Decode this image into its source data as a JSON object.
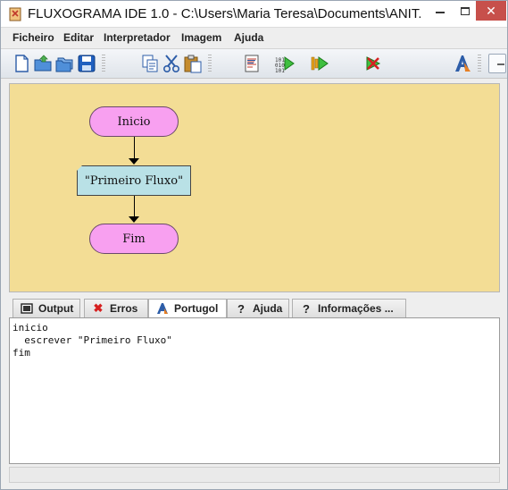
{
  "window": {
    "title": "FLUXOGRAMA IDE 1.0 - C:\\Users\\Maria Teresa\\Documents\\ANIT..."
  },
  "menu": {
    "items": [
      {
        "label": "Ficheiro"
      },
      {
        "label": "Editar"
      },
      {
        "label": "Interpretador"
      },
      {
        "label": "Imagem"
      },
      {
        "label": "Ajuda"
      }
    ]
  },
  "toolbar": {
    "buttons": [
      {
        "icon": "new-file-icon"
      },
      {
        "icon": "open-folder-icon"
      },
      {
        "icon": "open-multiple-icon"
      },
      {
        "icon": "save-icon"
      },
      {
        "icon": "copy-icon"
      },
      {
        "icon": "cut-icon"
      },
      {
        "icon": "paste-icon"
      },
      {
        "icon": "code-view-icon"
      },
      {
        "icon": "run-binary-icon"
      },
      {
        "icon": "run-step-icon"
      },
      {
        "icon": "stop-icon"
      },
      {
        "icon": "font-icon"
      }
    ]
  },
  "flowchart": {
    "nodes": [
      {
        "type": "terminal",
        "label": "Inicio"
      },
      {
        "type": "output",
        "label": "\"Primeiro Fluxo\""
      },
      {
        "type": "terminal",
        "label": "Fim"
      }
    ]
  },
  "tabs": [
    {
      "label": "Output",
      "icon": "console-icon",
      "active": false
    },
    {
      "label": "Erros",
      "icon": "error-x-icon",
      "active": false
    },
    {
      "label": "Portugol",
      "icon": "portugol-icon",
      "active": true
    },
    {
      "label": "Ajuda",
      "icon": "help-icon",
      "active": false
    },
    {
      "label": "Informações ...",
      "icon": "info-help-icon",
      "active": false
    }
  ],
  "editor": {
    "lines": [
      "inicio",
      "  escrever \"Primeiro Fluxo\"",
      "fim"
    ]
  },
  "colors": {
    "canvas_bg": "#f3dd95",
    "terminal_fill": "#f8a0f0",
    "output_fill": "#b9e1e6",
    "close_button": "#c7504b"
  }
}
